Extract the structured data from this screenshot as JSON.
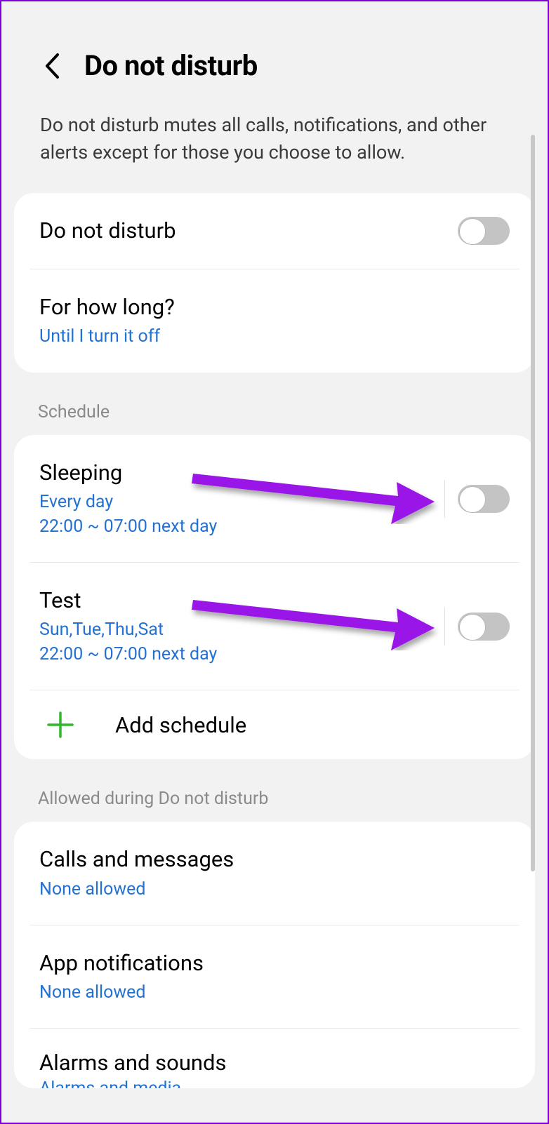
{
  "header": {
    "title": "Do not disturb"
  },
  "description": "Do not disturb mutes all calls, notifications, and other alerts except for those you choose to allow.",
  "main_card": {
    "dnd_label": "Do not disturb",
    "how_long_label": "For how long?",
    "how_long_value": "Until I turn it off"
  },
  "sections": {
    "schedule_header": "Schedule",
    "allowed_header": "Allowed during Do not disturb"
  },
  "schedules": [
    {
      "title": "Sleeping",
      "days": "Every day",
      "time": "22:00 ~ 07:00 next day"
    },
    {
      "title": "Test",
      "days": "Sun,Tue,Thu,Sat",
      "time": "22:00 ~ 07:00 next day"
    }
  ],
  "add_schedule_label": "Add schedule",
  "allowed": {
    "calls_title": "Calls and messages",
    "calls_value": "None allowed",
    "apps_title": "App notifications",
    "apps_value": "None allowed",
    "alarms_title": "Alarms and sounds",
    "alarms_value": "Alarms and media"
  },
  "colors": {
    "link": "#2372d1",
    "annotation": "#9a12e8",
    "plus": "#2eb82e"
  }
}
